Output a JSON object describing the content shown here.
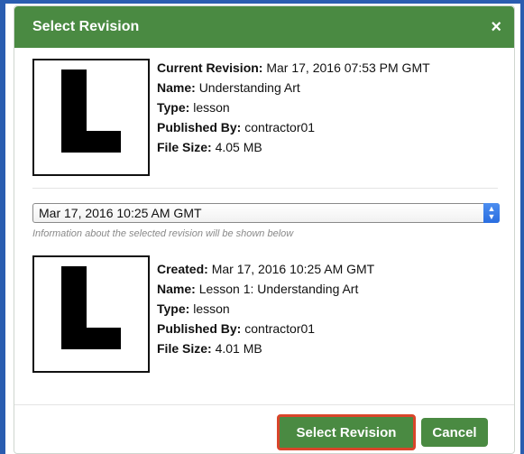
{
  "dialog": {
    "title": "Select Revision",
    "close_symbol": "×"
  },
  "current": {
    "thumbnail_letter": "L",
    "rows": [
      {
        "key": "Current Revision:",
        "value": "Mar 17, 2016 07:53 PM GMT"
      },
      {
        "key": "Name:",
        "value": "Understanding Art"
      },
      {
        "key": "Type:",
        "value": "lesson"
      },
      {
        "key": "Published By:",
        "value": "contractor01"
      },
      {
        "key": "File Size:",
        "value": "4.05 MB"
      }
    ]
  },
  "revision_select": {
    "selected": "Mar 17, 2016 10:25 AM GMT",
    "helper_text": "Information about the selected revision will be shown below"
  },
  "selected": {
    "thumbnail_letter": "L",
    "rows": [
      {
        "key": "Created:",
        "value": "Mar 17, 2016 10:25 AM GMT"
      },
      {
        "key": "Name:",
        "value": "Lesson 1: Understanding Art"
      },
      {
        "key": "Type:",
        "value": "lesson"
      },
      {
        "key": "Published By:",
        "value": "contractor01"
      },
      {
        "key": "File Size:",
        "value": "4.01 MB"
      }
    ]
  },
  "buttons": {
    "select_label": "Select Revision",
    "cancel_label": "Cancel"
  },
  "colors": {
    "header": "#4a8a42",
    "button": "#4a8a42",
    "highlight_border": "#d9452a",
    "select_arrow": "#2a6ee0",
    "page_frame": "#2a5db0"
  },
  "icons": {
    "close": "close-icon",
    "select_arrows": "select-arrows-icon",
    "thumbnail": "lesson-thumbnail-icon"
  }
}
